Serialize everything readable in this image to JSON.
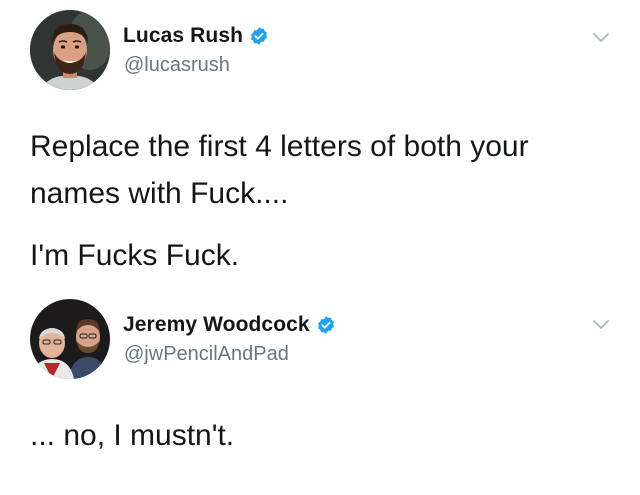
{
  "tweets": [
    {
      "display_name": "Lucas Rush",
      "handle": "@lucasrush",
      "verified": true,
      "avatar_icon": "profile-photo-bearded-man",
      "text_lines": [
        "Replace the first 4 letters of both your",
        "names with Fuck....",
        "I'm Fucks Fuck."
      ]
    },
    {
      "display_name": "Jeremy Woodcock",
      "handle": "@jwPencilAndPad",
      "verified": true,
      "avatar_icon": "profile-photo-two-men",
      "text_lines": [
        "... no, I mustn't."
      ]
    }
  ],
  "colors": {
    "verified_blue": "#1da1f2",
    "handle_gray": "#657786",
    "text": "#14171a",
    "chevron_gray": "#aab8c2"
  }
}
